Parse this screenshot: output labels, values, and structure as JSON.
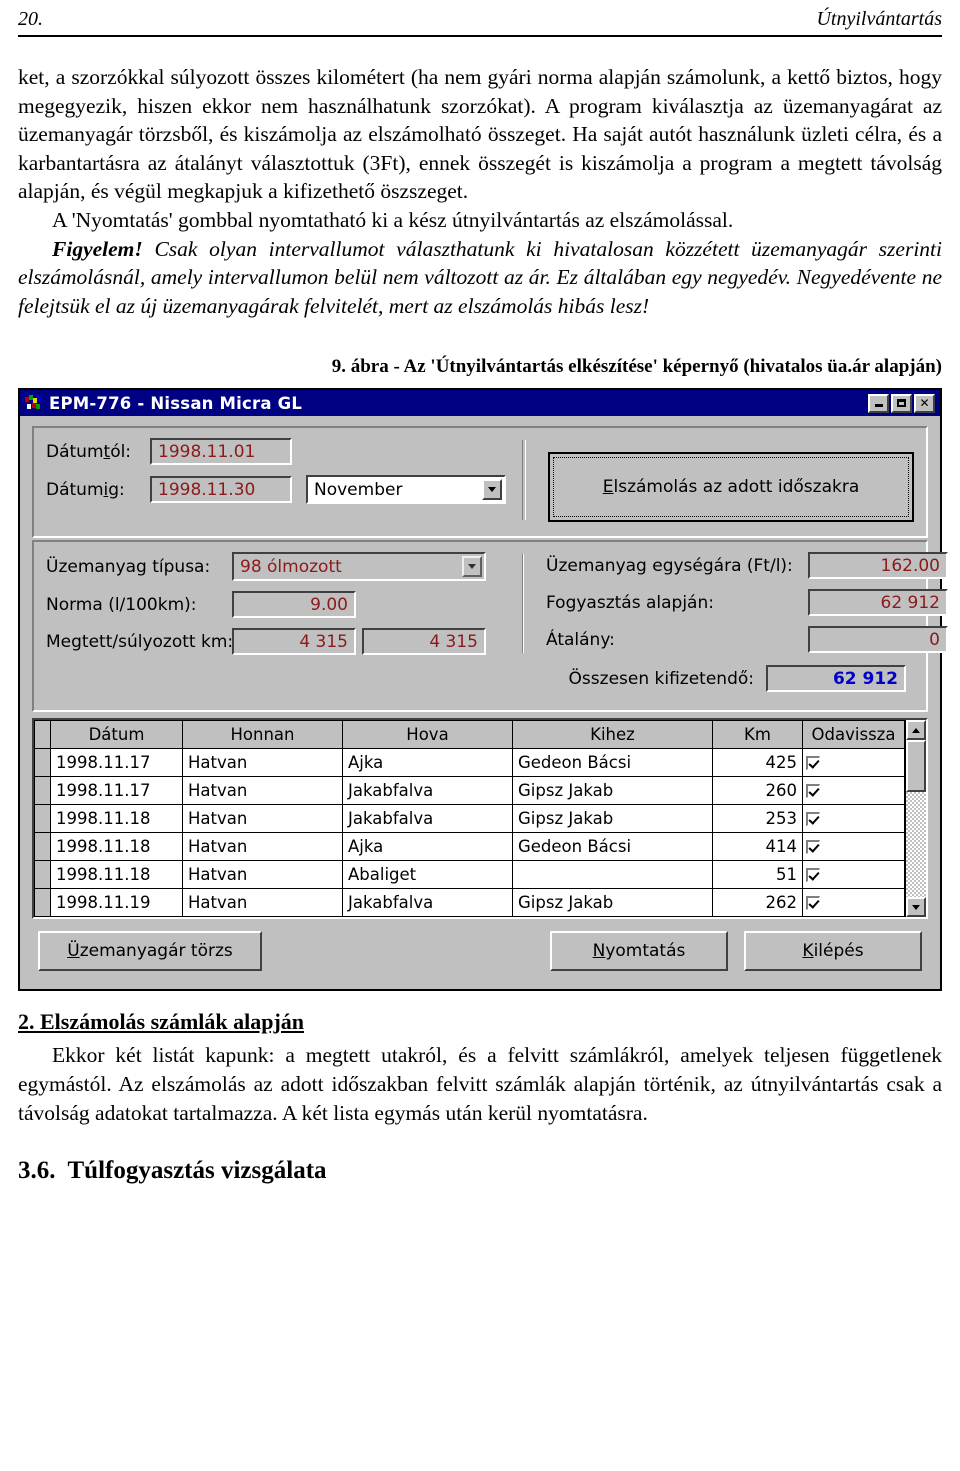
{
  "header": {
    "page_number": "20.",
    "running_title": "Útnyilvántartás"
  },
  "paragraphs": {
    "p1": "ket, a szorzókkal súlyozott összes kilométert (ha nem gyári norma alapján számolunk, a kettő biztos, hogy megegyezik, hiszen ekkor nem használhatunk szorzókat). A program kiválasztja az üzemanyagárat az üzemanyagár törzsből, és kiszámolja az elszámolható összeget. Ha saját autót használunk üzleti célra, és a karbantartásra az átalányt választottuk (3Ft), ennek összegét is kiszámolja a program a megtett távolság alapján, és végül megkapjuk a kifizethető öszszeget.",
    "p2": "A 'Nyomtatás' gombbal nyomtatható ki a kész útnyilvántartás az elszámolással.",
    "warn_label": "Figyelem!",
    "warn_body": " Csak olyan intervallumot választhatunk ki hivatalosan közzétett üzemanyagár szerinti elszámolásnál, amely intervallumon belül nem változott az ár. Ez általában egy negyedév. Negyedévente ne felejtsük el az új üzemanyagárak felvitelét, mert az elszámolás hibás lesz!"
  },
  "figure": {
    "caption": "9. ábra - Az 'Útnyilvántartás elkészítése' képernyő (hivatalos üa.ár alapján)"
  },
  "window": {
    "title": "EPM-776 - Nissan Micra GL",
    "minimize_label": "_",
    "maximize_label": "□",
    "close_label": "x",
    "titlebar_color": "#000082",
    "face_color": "#c0c0c0",
    "value_color": "#8b1a1a",
    "total_color": "#0000c8",
    "fields": {
      "date_from_label_pre": "Dátum",
      "date_from_label_accel": "t",
      "date_from_label_post": "ól:",
      "date_from_value": "1998.11.01",
      "date_to_label_pre": "Dátum",
      "date_to_label_accel": "i",
      "date_to_label_post": "g:",
      "date_to_value": "1998.11.30",
      "month_value": "November",
      "fuel_type_label": "Üzemanyag típusa:",
      "fuel_type_value": "98 ólmozott",
      "norm_label": "Norma (l/100km):",
      "norm_value": "9.00",
      "distance_label": "Megtett/súlyozott km:",
      "distance_value": "4 315",
      "weighted_value": "4 315",
      "unit_price_label": "Üzemanyag egységára (Ft/l):",
      "unit_price_value": "162.00",
      "consumption_label": "Fogyasztás alapján:",
      "consumption_value": "62 912",
      "flat_rate_label": "Átalány:",
      "flat_rate_value": "0",
      "total_label": "Összesen kifizetendő:",
      "total_value": "62 912"
    },
    "buttons": {
      "calculate_pre": "",
      "calculate_accel": "E",
      "calculate_post": "lszámolás az adott időszakra",
      "fuel_master_accel": "Ü",
      "fuel_master_post": "zemanyagár törzs",
      "print_accel": "N",
      "print_post": "yomtatás",
      "exit_accel": "K",
      "exit_post": "ilépés"
    },
    "table": {
      "columns": [
        "Dátum",
        "Honnan",
        "Hova",
        "Kihez",
        "Km",
        "Odavissza"
      ],
      "rows": [
        {
          "datum": "1998.11.17",
          "honnan": "Hatvan",
          "hova": "Ajka",
          "kihez": "Gedeon Bácsi",
          "km": "425",
          "odavissza": true
        },
        {
          "datum": "1998.11.17",
          "honnan": "Hatvan",
          "hova": "Jakabfalva",
          "kihez": "Gipsz Jakab",
          "km": "260",
          "odavissza": true
        },
        {
          "datum": "1998.11.18",
          "honnan": "Hatvan",
          "hova": "Jakabfalva",
          "kihez": "Gipsz Jakab",
          "km": "253",
          "odavissza": true
        },
        {
          "datum": "1998.11.18",
          "honnan": "Hatvan",
          "hova": "Ajka",
          "kihez": "Gedeon Bácsi",
          "km": "414",
          "odavissza": true
        },
        {
          "datum": "1998.11.18",
          "honnan": "Hatvan",
          "hova": "Abaliget",
          "kihez": "",
          "km": "51",
          "odavissza": true
        },
        {
          "datum": "1998.11.19",
          "honnan": "Hatvan",
          "hova": "Jakabfalva",
          "kihez": "Gipsz Jakab",
          "km": "262",
          "odavissza": true
        }
      ]
    }
  },
  "sections": {
    "sec2_heading": "2. Elszámolás számlák alapján",
    "sec2_body": "Ekkor két listát kapunk: a megtett utakról, és a felvitt számlákról, amelyek teljesen függetlenek egymástól. Az elszámolás az adott időszakban felvitt számlák alapján történik, az útnyilvántartás csak a távolság adatokat tartalmazza. A két lista egymás után kerül nyomtatásra.",
    "sec36_number": "3.6.",
    "sec36_title": "Túlfogyasztás vizsgálata"
  }
}
